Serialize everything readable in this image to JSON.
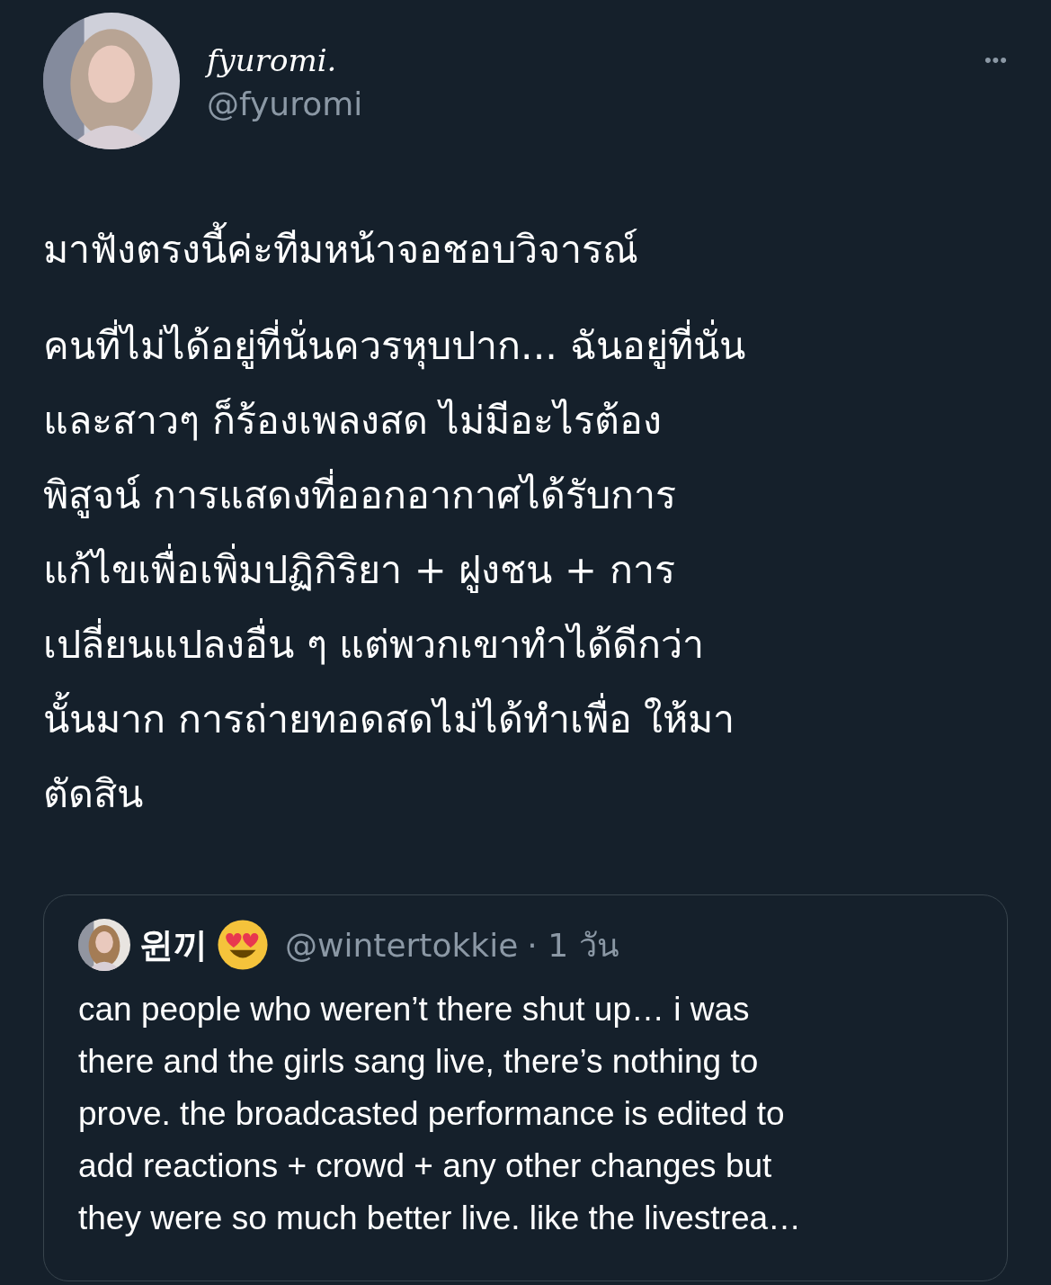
{
  "author": {
    "name": "fyuromi.",
    "handle": "@fyuromi"
  },
  "more_button": "•••",
  "text_paragraphs": [
    [
      "มาฟังตรงนี้ค่ะทีมหน้าจอชอบวิจารณ์"
    ],
    [
      "คนที่ไม่ได้อยู่ที่นั่นควรหุบปาก... ฉันอยู่ที่นั่น",
      "และสาวๆ ก็ร้องเพลงสด ไม่มีอะไรต้อง",
      "พิสูจน์  การแสดงที่ออกอากาศได้รับการ",
      "แก้ไขเพื่อเพิ่มปฏิกิริยา + ฝูงชน + การ",
      "เปลี่ยนแปลงอื่น ๆ แต่พวกเขาทำได้ดีกว่า",
      "นั้นมาก การถ่ายทอดสดไม่ได้ทำเพื่อ ให้มา",
      "ตัดสิน"
    ]
  ],
  "quoted_tweet": {
    "name": "윈끼",
    "handle": "@wintertokkie",
    "time": "· 1 วัน",
    "text_lines": [
      "can people who weren’t there shut up… i was",
      "there and the girls sang live, there’s nothing to",
      "prove. the broadcasted performance is edited to",
      "add reactions + crowd + any other changes but",
      "they were so much better live. like the livestrea…"
    ]
  }
}
